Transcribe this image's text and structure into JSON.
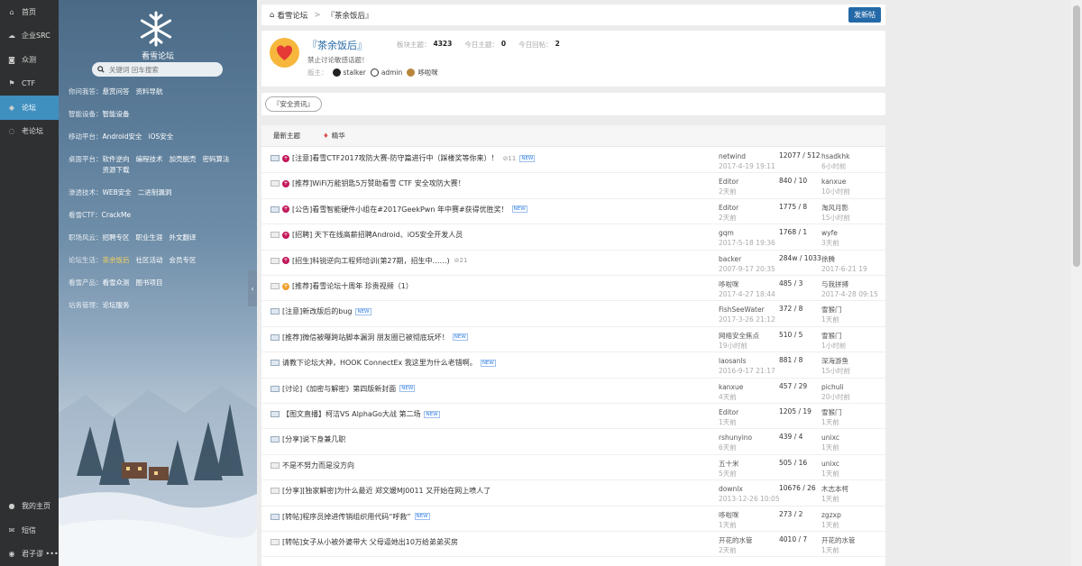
{
  "nav": {
    "items": [
      {
        "label": "首页",
        "icon": "home-icon",
        "glyph": "⌂"
      },
      {
        "label": "企业SRC",
        "icon": "cloud-icon",
        "glyph": "☁"
      },
      {
        "label": "众测",
        "icon": "camera-icon",
        "glyph": "◙"
      },
      {
        "label": "CTF",
        "icon": "flag-icon",
        "glyph": "⚑"
      },
      {
        "label": "论坛",
        "icon": "chat-icon",
        "glyph": "◆",
        "active": true
      },
      {
        "label": "老论坛",
        "icon": "chat-bubble-icon",
        "glyph": "◌"
      }
    ],
    "bottom": [
      {
        "label": "我的主页",
        "icon": "user-icon",
        "glyph": "●"
      },
      {
        "label": "短信",
        "icon": "mail-icon",
        "glyph": "✉"
      },
      {
        "label": "君子谬 •••",
        "icon": "user-avatar-icon",
        "glyph": "◉"
      }
    ]
  },
  "sidebar": {
    "logo_text": "看雪论坛",
    "search_placeholder": "关键词 回车搜索",
    "categories": [
      {
        "key": "你问我答：",
        "vals": [
          "悬赏问答",
          "资料导航"
        ]
      },
      {
        "key": "智能设备：",
        "vals": [
          "智能设备"
        ]
      },
      {
        "key": "移动平台：",
        "vals": [
          "Android安全",
          "iOS安全"
        ]
      },
      {
        "key": "桌面平台：",
        "vals": [
          "软件逆向",
          "编程技术",
          "加壳脱壳",
          "密码算法",
          "资源下载"
        ]
      },
      {
        "key": "渗透技术：",
        "vals": [
          "WEB安全",
          "二进制漏洞"
        ]
      },
      {
        "key": "看雪CTF：",
        "vals": [
          "CrackMe"
        ]
      },
      {
        "key": "职场风云：",
        "vals": [
          "招聘专区",
          "职业生涯",
          "外文翻译"
        ]
      },
      {
        "key": "论坛生活：",
        "vals": [
          "茶余饭后",
          "社区活动",
          "会员专区"
        ],
        "hl": 0
      },
      {
        "key": "看雪产品：",
        "vals": [
          "看雪众测",
          "图书项目"
        ]
      },
      {
        "key": "站务管理：",
        "vals": [
          "论坛服务"
        ]
      }
    ]
  },
  "breadcrumb": {
    "home": "看雪论坛",
    "sep": ">",
    "current": "『茶余饭后』",
    "post_btn": "发新帖"
  },
  "forum": {
    "title": "『茶余饭后』",
    "stat1_label": "板块主题：",
    "stat1_value": "4323",
    "stat2_label": "今日主题：",
    "stat2_value": "0",
    "stat3_label": "今日回帖：",
    "stat3_value": "2",
    "desc": "禁止讨论敏感话题！",
    "mods_label": "版主：",
    "mods": [
      "stalker",
      "admin",
      "哆啦咪"
    ]
  },
  "tags": [
    "『安全资讯』"
  ],
  "tabs": [
    "最新主题",
    "精华"
  ],
  "threads": [
    {
      "title": "[注意]看雪CTF2017攻防大赛-防守篇进行中（踩楼奖等你来）！",
      "dot": "#c2185b",
      "env": "blue",
      "extra": "⊘11",
      "new": true,
      "author": "netwind",
      "date": "2017-4-19 19:11",
      "count": "12077 / 512",
      "last": "hsadkhk",
      "ltime": "6小时前"
    },
    {
      "title": "[推荐]WiFi万能钥匙5万赞助看雪 CTF 安全攻防大赛！",
      "dot": "#c2185b",
      "env": "grey",
      "extra": "",
      "new": false,
      "author": "Editor",
      "date": "2天前",
      "count": "840 / 10",
      "last": "kanxue",
      "ltime": "10小时前"
    },
    {
      "title": "[公告]看雪智能硬件小组在#2017GeekPwn 年中赛#获得优胜奖！",
      "dot": "#c2185b",
      "env": "blue",
      "extra": "",
      "new": true,
      "author": "Editor",
      "date": "2天前",
      "count": "1775 / 8",
      "last": "淘风月影",
      "ltime": "15小时前"
    },
    {
      "title": "[招聘] 天下在线高薪招聘Android、iOS安全开发人员",
      "dot": "#c2185b",
      "env": "grey",
      "extra": "",
      "new": false,
      "author": "gqm",
      "date": "2017-5-18 19:36",
      "count": "1768 / 1",
      "last": "wyfe",
      "ltime": "3天前"
    },
    {
      "title": "[招生]科锐逆向工程师培训(第27期，招生中……)",
      "dot": "#c2185b",
      "env": "grey",
      "extra": "⊘21",
      "new": false,
      "author": "backer",
      "date": "2007-9-17 20:35",
      "count": "284w / 1033",
      "last": "徐腾",
      "ltime": "2017-6-21 19"
    },
    {
      "title": "[推荐]看雪论坛十周年 珍贵视频（1）",
      "dot": "#f0a030",
      "env": "grey",
      "extra": "",
      "new": false,
      "author": "哆啦咪",
      "date": "2017-4-27 18:44",
      "count": "485 / 3",
      "last": "与我拼搏",
      "ltime": "2017-4-28 09:15"
    },
    {
      "title": "[注意]新改版后的bug",
      "dot": "",
      "env": "blue",
      "extra": "",
      "new": true,
      "author": "FishSeeWater",
      "date": "2017-3-26 21:12",
      "count": "372 / 8",
      "last": "雪猴门",
      "ltime": "1天前"
    },
    {
      "title": "[推荐]微信被曝跨站脚本漏洞 朋友圈已被彻底玩坏！",
      "dot": "",
      "env": "blue",
      "extra": "",
      "new": true,
      "author": "网络安全焦点",
      "date": "19小时前",
      "count": "510 / 5",
      "last": "雪猴门",
      "ltime": "1小时前"
    },
    {
      "title": "请教下论坛大神，HOOK ConnectEx 我这里为什么老错啊。",
      "dot": "",
      "env": "blue",
      "extra": "",
      "new": true,
      "author": "laosanls",
      "date": "2016-9-17 21:17",
      "count": "881 / 8",
      "last": "深海游鱼",
      "ltime": "15小时前"
    },
    {
      "title": "[讨论]《加密与解密》第四版新封面",
      "dot": "",
      "env": "blue",
      "extra": "",
      "new": true,
      "author": "kanxue",
      "date": "4天前",
      "count": "457 / 29",
      "last": "pichuli",
      "ltime": "20小时前"
    },
    {
      "title": "【图文直播】柯洁VS AlphaGo大战 第二场",
      "dot": "",
      "env": "blue",
      "extra": "",
      "new": true,
      "author": "Editor",
      "date": "1天前",
      "count": "1205 / 19",
      "last": "雪猴门",
      "ltime": "1天前"
    },
    {
      "title": "[分享]说下身兼几职",
      "dot": "",
      "env": "blue",
      "extra": "",
      "new": false,
      "author": "rshunyino",
      "date": "6天前",
      "count": "439 / 4",
      "last": "unixc",
      "ltime": "1天前"
    },
    {
      "title": "不是不努力而是没方向",
      "dot": "",
      "env": "grey",
      "extra": "",
      "new": false,
      "author": "五十米",
      "date": "5天前",
      "count": "505 / 16",
      "last": "unixc",
      "ltime": "1天前"
    },
    {
      "title": "[分享][独家解密]为什么最近 郑文媛MJ0011 又开始在网上喷人了",
      "dot": "",
      "env": "grey",
      "extra": "",
      "new": false,
      "author": "downlx",
      "date": "2013-12-26 10:05",
      "count": "10676 / 26",
      "last": "木志本柯",
      "ltime": "1天前"
    },
    {
      "title": "[转帖]程序员掉进传销组织用代码“呼救”",
      "dot": "",
      "env": "blue",
      "extra": "",
      "new": true,
      "author": "哆啦咪",
      "date": "1天前",
      "count": "273 / 2",
      "last": "zgzxp",
      "ltime": "1天前"
    },
    {
      "title": "[转帖]女子从小被外婆带大 父母逼她出10万给弟弟买房",
      "dot": "",
      "env": "grey",
      "extra": "",
      "new": false,
      "author": "开花的水管",
      "date": "2天前",
      "count": "4010 / 7",
      "last": "开花的水管",
      "ltime": "1天前"
    }
  ],
  "new_badge": "NEW"
}
